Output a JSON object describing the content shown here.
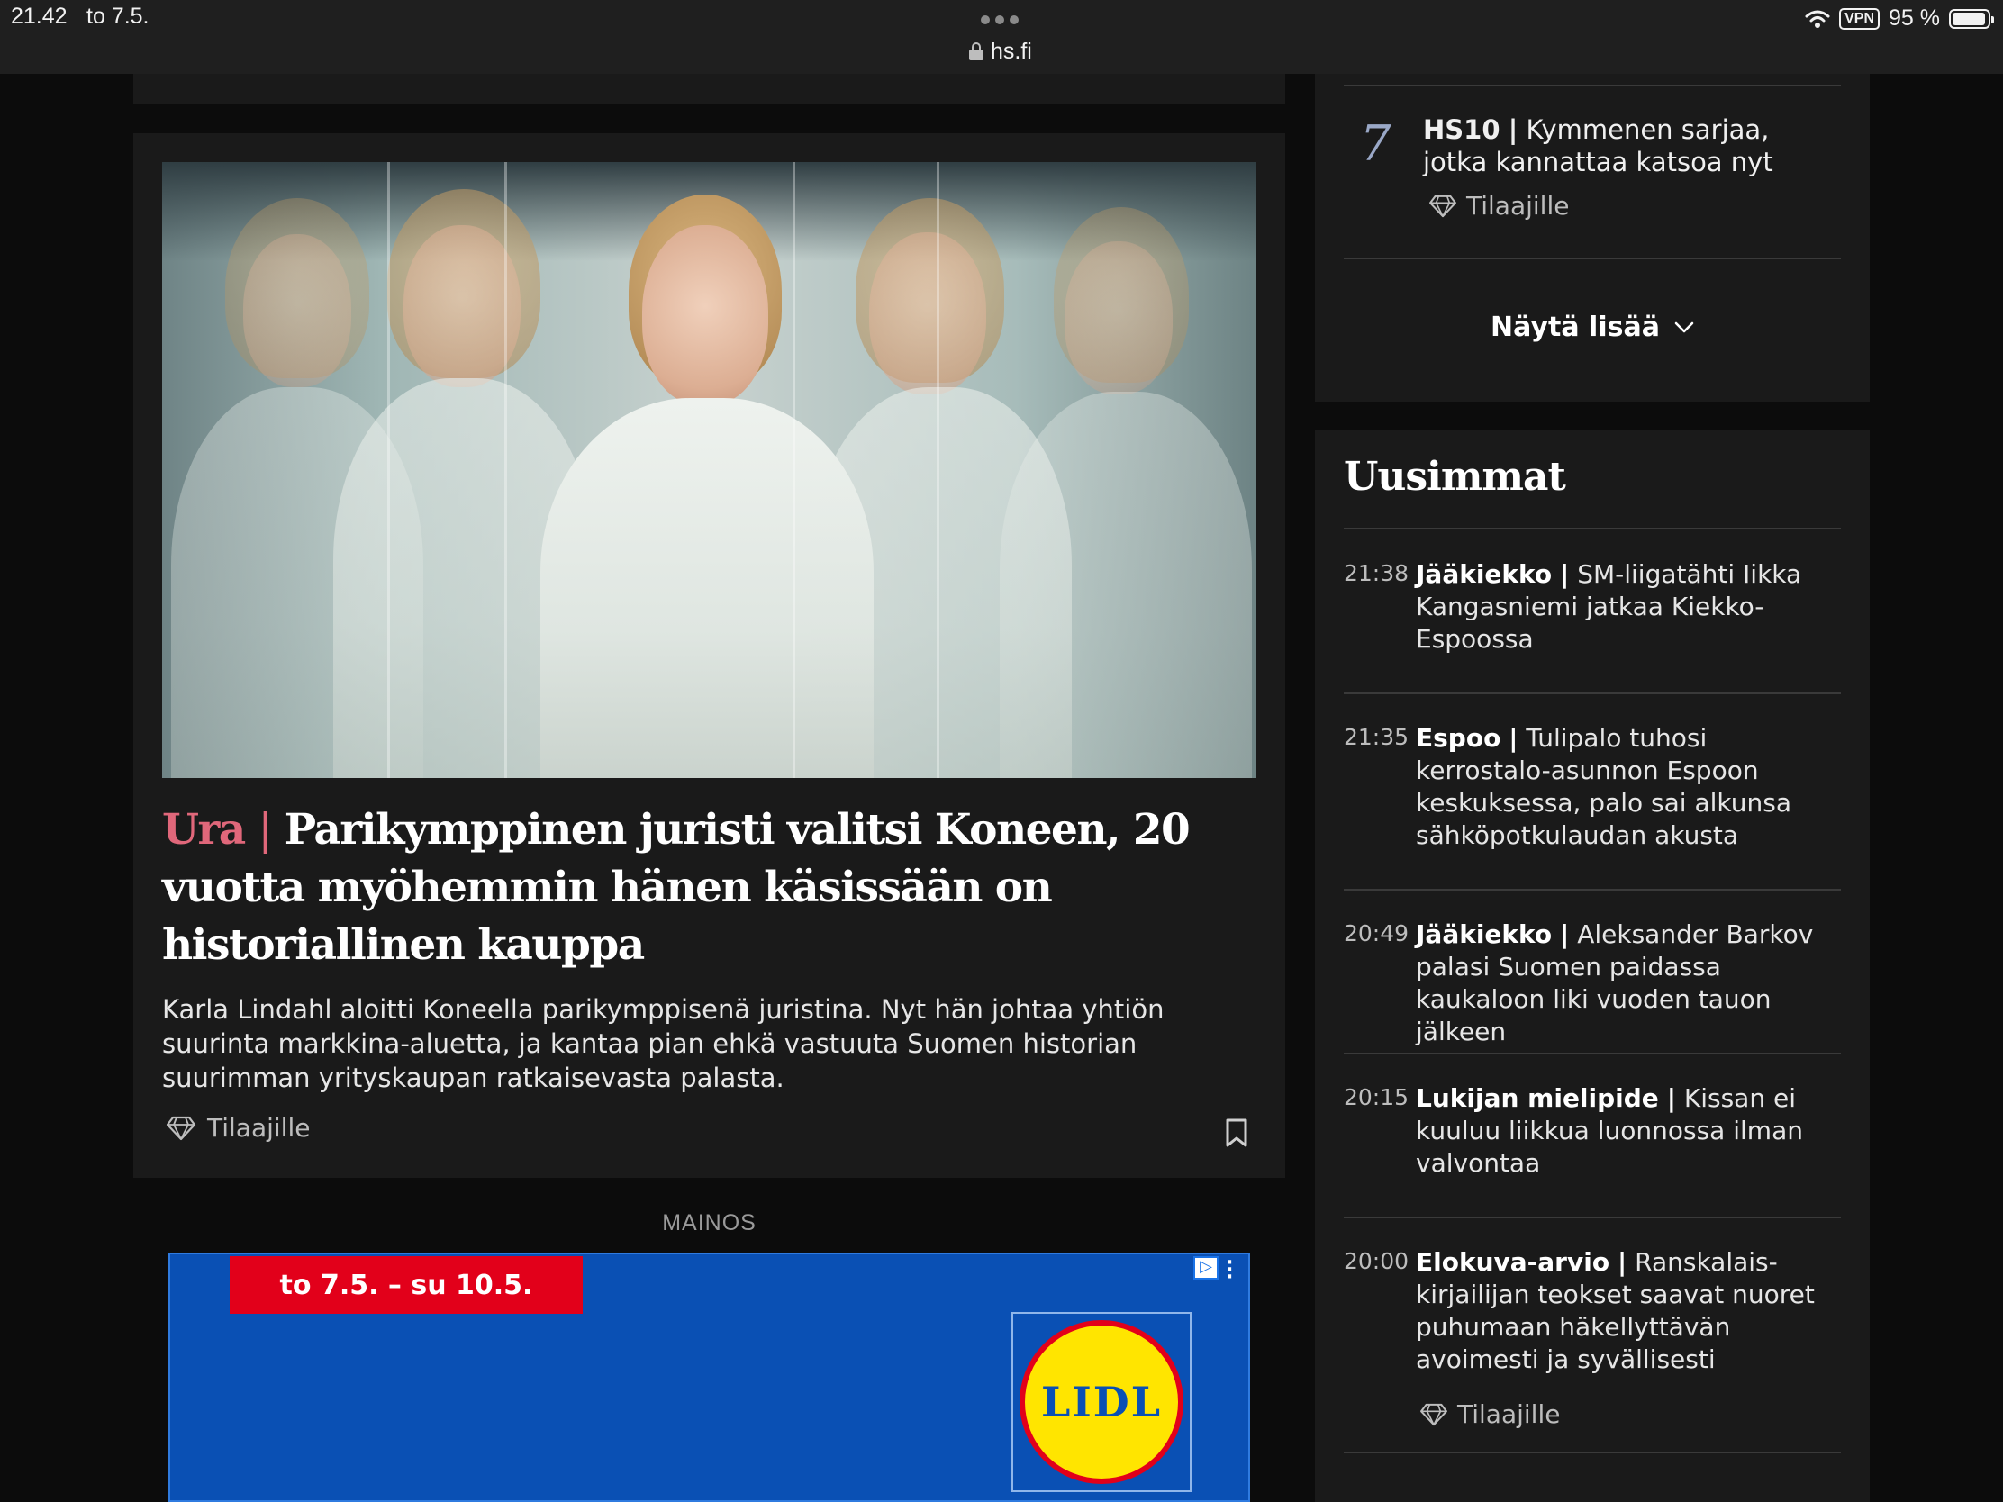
{
  "status_bar": {
    "time": "21.42",
    "date": "to 7.5.",
    "url": "hs.fi",
    "vpn": "VPN",
    "battery": "95 %"
  },
  "main": {
    "article": {
      "kicker": "Ura",
      "separator": "|",
      "title": "Parikymppinen juristi valitsi Koneen, 20 vuotta myöhemmin hänen käsissään on historiallinen kauppa",
      "lead": "Karla Lindahl aloitti Koneella parikymppisenä juristina. Nyt hän johtaa yhtiön suurinta markkina-aluetta, ja kantaa pian ehkä vastuuta Suomen historian suurimman yrityskaupan ratkaisevasta palasta.",
      "subscriber_label": "Tilaajille"
    },
    "ad": {
      "label": "MAINOS",
      "date_range": "to 7.5. – su 10.5.",
      "brand": "LIDL"
    }
  },
  "sidebar": {
    "hs10": {
      "rank": "7",
      "kicker": "HS10",
      "separator": "|",
      "title": "Kymmenen sarjaa, jotka kannattaa katsoa nyt",
      "subscriber_label": "Tilaajille"
    },
    "show_more_label": "Näytä lisää",
    "latest_title": "Uusimmat",
    "latest": [
      {
        "time": "21:38",
        "kicker": "Jääkiekko",
        "separator": "|",
        "title": "SM-liigatähti Iikka Kangasniemi jatkaa Kiekko-Espoossa"
      },
      {
        "time": "21:35",
        "kicker": "Espoo",
        "separator": "|",
        "title": "Tulipalo tuhosi kerrostalo-asunnon Espoon keskuksessa, palo sai alkunsa sähköpotkulaudan akusta"
      },
      {
        "time": "20:49",
        "kicker": "Jääkiekko",
        "separator": "|",
        "title": "Aleksander Barkov palasi Suomen paidassa kaukaloon liki vuoden tauon jälkeen"
      },
      {
        "time": "20:15",
        "kicker": "Lukijan mielipide",
        "separator": "|",
        "title": "Kissan ei kuuluu liikkua luonnossa ilman valvontaa"
      },
      {
        "time": "20:00",
        "kicker": "Elokuva-arvio",
        "separator": "|",
        "title": "Ranskalais-kirjailijan teokset saavat nuoret puhumaan häkellyttävän avoimesti ja syvällisesti",
        "subscriber_label": "Tilaajille"
      }
    ]
  },
  "colors": {
    "background": "#0c0c0c",
    "card": "#1a1a1a",
    "kicker_accent": "#e0677a",
    "ad_blue": "#0a50b4",
    "ad_red": "#e2001a",
    "ad_yellow": "#ffe500"
  },
  "icons": [
    "lock-icon",
    "wifi-icon",
    "battery-icon",
    "diamond-icon",
    "bookmark-icon",
    "chevron-down-icon",
    "adchoices-icon",
    "more-dots-icon"
  ]
}
